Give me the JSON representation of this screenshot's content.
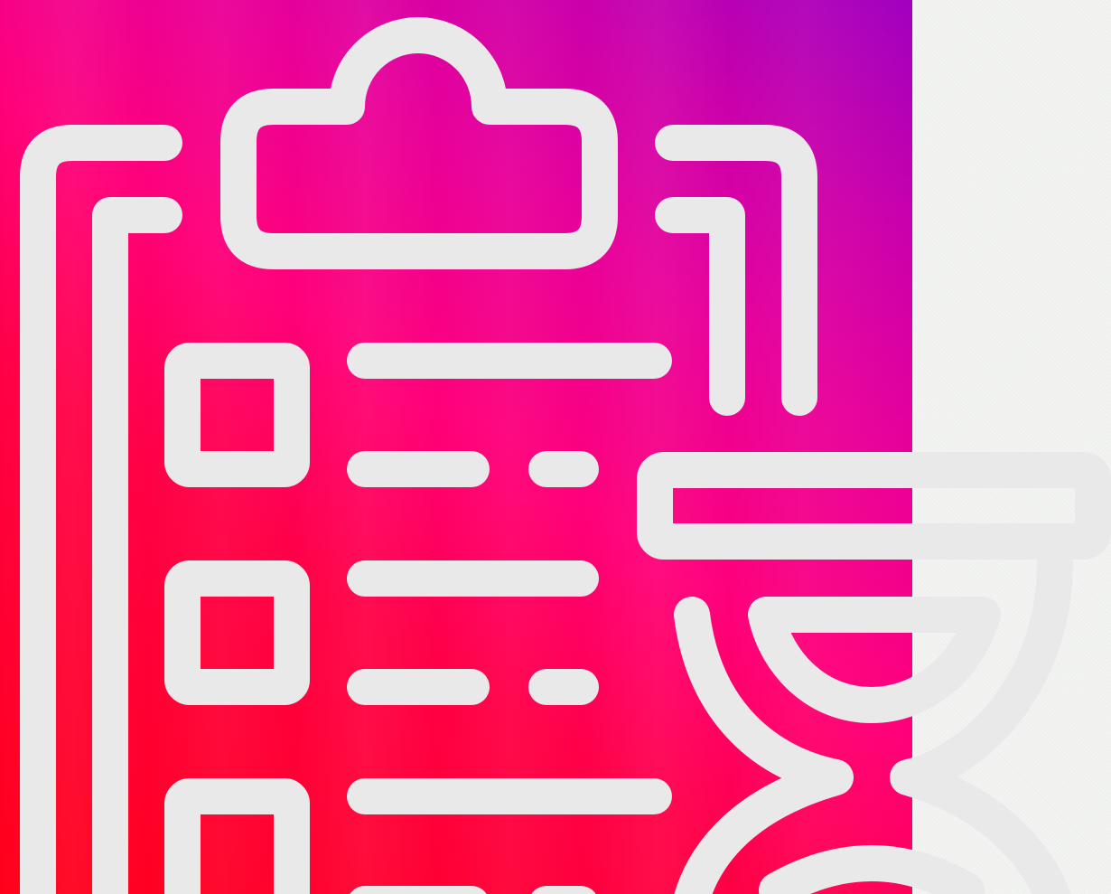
{
  "scene": {
    "icon_names": [
      "clipboard-checklist-icon",
      "hourglass-icon"
    ],
    "colors": {
      "background_gradient": [
        "#ff0019",
        "#ff0046",
        "#ff007a",
        "#e8009a",
        "#cc00aa",
        "#a100bf"
      ],
      "icon_stroke": "#e9e9e9",
      "noise_panel": "#f3f4f2"
    }
  }
}
